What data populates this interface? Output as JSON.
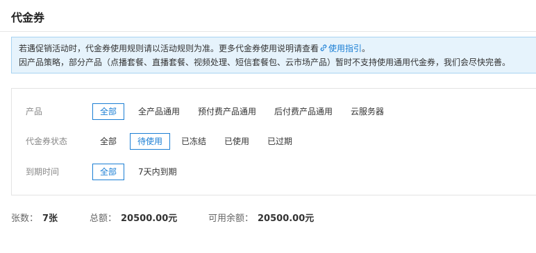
{
  "header": {
    "title": "代金券"
  },
  "notice": {
    "line1_prefix": "若遇促销活动时，代金券使用规则请以活动规则为准。更多代金券使用说明请查看",
    "line1_link": "使用指引",
    "line1_suffix": "。",
    "line2": "因产品策略，部分产品（点播套餐、直播套餐、视频处理、短信套餐包、云市场产品）暂时不支持使用通用代金券，我们会尽快完善。",
    "link_icon": "link-icon"
  },
  "filters": {
    "product": {
      "label": "产品",
      "options": [
        "全部",
        "全产品通用",
        "预付费产品通用",
        "后付费产品通用",
        "云服务器"
      ],
      "selected": "全部"
    },
    "status": {
      "label": "代金券状态",
      "options": [
        "全部",
        "待使用",
        "已冻结",
        "已使用",
        "已过期"
      ],
      "selected": "待使用"
    },
    "expiry": {
      "label": "到期时间",
      "options": [
        "全部",
        "7天内到期"
      ],
      "selected": "全部"
    }
  },
  "summary": {
    "count_label": "张数：",
    "count_value": "7张",
    "total_label": "总额：",
    "total_value": "20500.00元",
    "available_label": "可用余额：",
    "available_value": "20500.00元"
  },
  "colors": {
    "accent": "#1a7ed4",
    "notice_bg": "#e6f3fc",
    "notice_border": "#a6d2f2"
  }
}
